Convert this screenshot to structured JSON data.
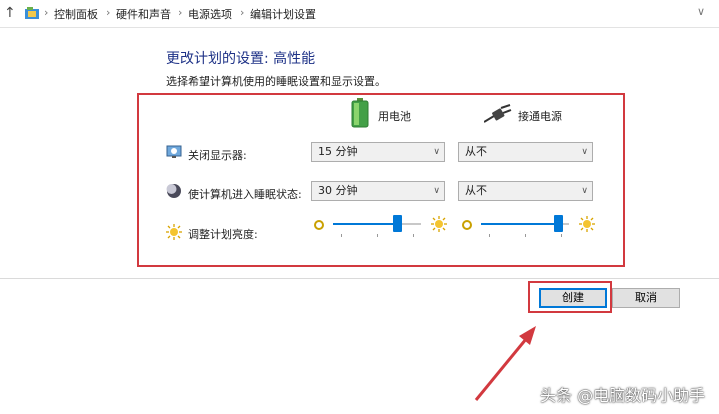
{
  "breadcrumb": {
    "items": [
      "控制面板",
      "硬件和声音",
      "电源选项",
      "编辑计划设置"
    ]
  },
  "page": {
    "title": "更改计划的设置: 高性能",
    "subtitle": "选择希望计算机使用的睡眠设置和显示设置。"
  },
  "columns": {
    "battery": "用电池",
    "plugged_in": "接通电源"
  },
  "settings": {
    "display_off": {
      "label": "关闭显示器:",
      "battery": "15 分钟",
      "plugged_in": "从不"
    },
    "sleep": {
      "label": "使计算机进入睡眠状态:",
      "battery": "30 分钟",
      "plugged_in": "从不"
    },
    "brightness": {
      "label": "调整计划亮度:",
      "battery_level": 0.76,
      "plugged_in_level": 0.93
    }
  },
  "buttons": {
    "create": "创建",
    "cancel": "取消"
  },
  "watermark": "头条 @电脑数码小助手",
  "colors": {
    "accent": "#0078d7",
    "highlight": "#d2393f",
    "title": "#1e3287"
  },
  "icons": [
    "up-arrow-icon",
    "control-panel-icon",
    "battery-icon",
    "plug-icon",
    "monitor-icon",
    "moon-icon",
    "sun-icon"
  ]
}
